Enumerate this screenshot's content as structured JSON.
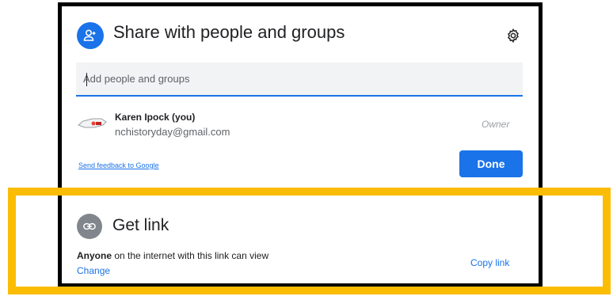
{
  "share_section": {
    "title": "Share with people and groups",
    "icon": "person-add-icon",
    "settings_icon": "gear-icon",
    "add_input": {
      "value": "",
      "placeholder": "Add people and groups"
    },
    "owner": {
      "name": "Karen Ipock (you)",
      "email": "nchistoryday@gmail.com",
      "role": "Owner"
    },
    "feedback_link": "Send feedback to Google",
    "done_label": "Done"
  },
  "link_section": {
    "title": "Get link",
    "icon": "link-icon",
    "description_bold": "Anyone",
    "description_rest": " on the internet with this link can view",
    "change_label": "Change",
    "copy_label": "Copy link"
  },
  "colors": {
    "primary_blue": "#1a73e8",
    "highlight_yellow": "#FBBC04",
    "frame_black": "#000000",
    "link_icon_grey": "#80868b"
  }
}
